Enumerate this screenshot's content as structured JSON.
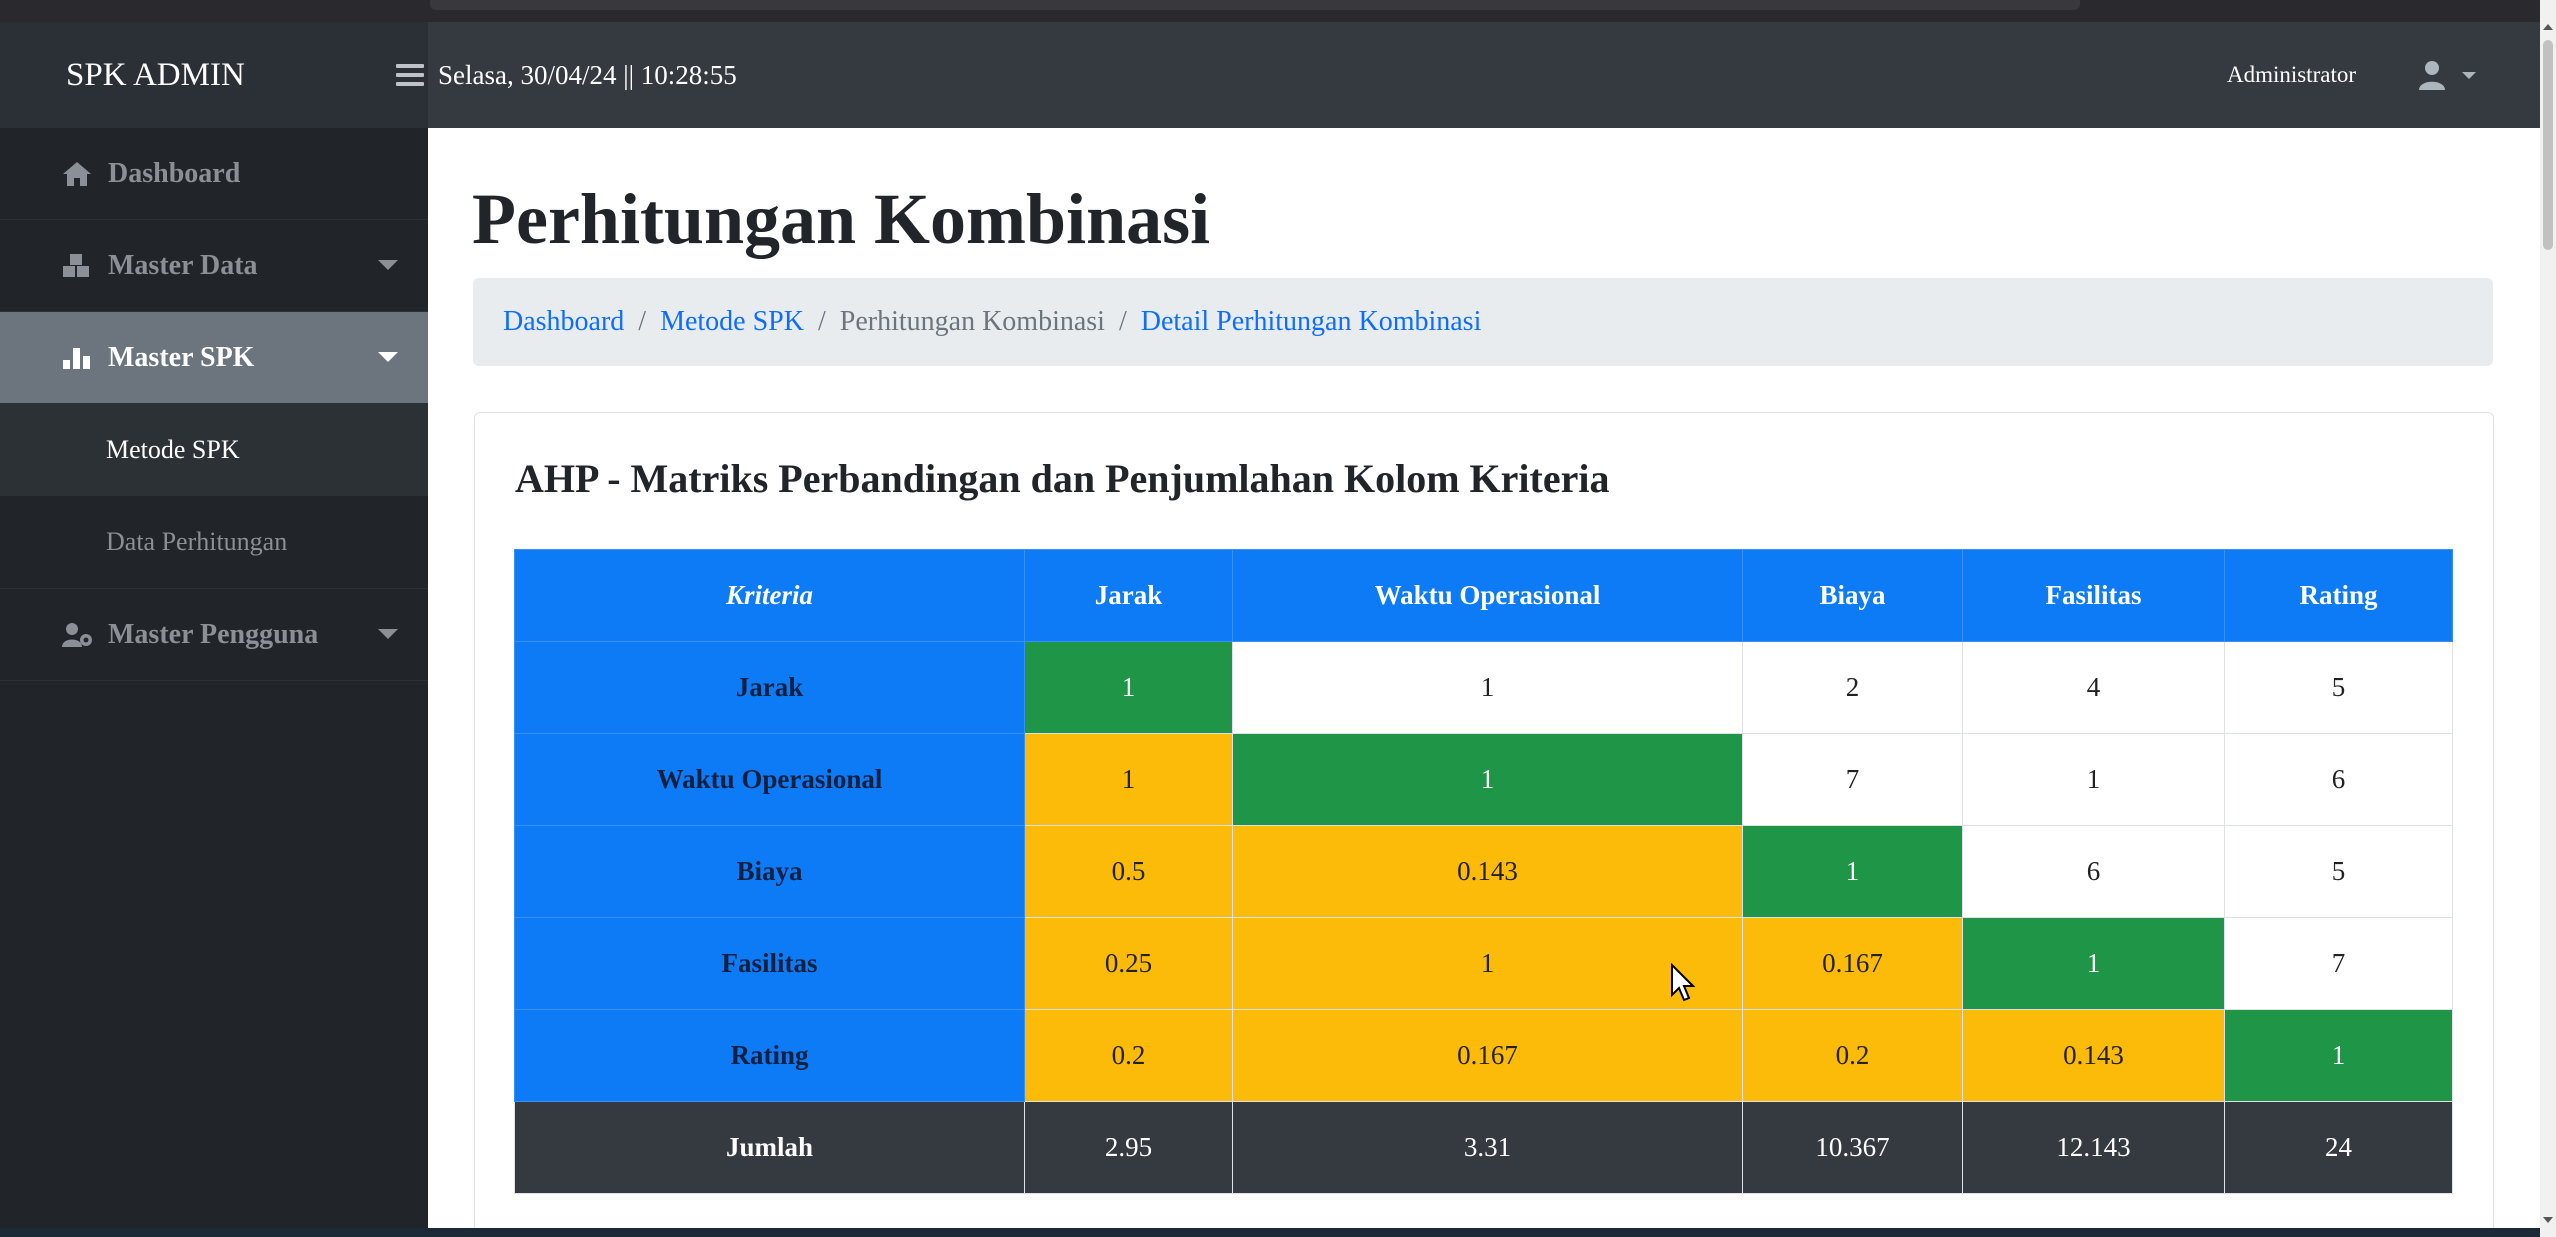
{
  "navbar": {
    "brand": "SPK ADMIN",
    "datetime": "Selasa, 30/04/24 || 10:28:55",
    "user_name": "Administrator"
  },
  "sidebar": {
    "items": [
      {
        "label": "Dashboard",
        "icon": "home-icon"
      },
      {
        "label": "Master Data",
        "icon": "cubes-icon"
      },
      {
        "label": "Master SPK",
        "icon": "chart-icon",
        "active": true
      },
      {
        "label": "Master Pengguna",
        "icon": "users-cog-icon"
      }
    ],
    "sub_items": [
      {
        "label": "Metode SPK",
        "selected": true
      },
      {
        "label": "Data Perhitungan"
      }
    ]
  },
  "page": {
    "title": "Perhitungan Kombinasi",
    "breadcrumb": [
      {
        "label": "Dashboard",
        "link": true
      },
      {
        "label": "Metode SPK",
        "link": true
      },
      {
        "label": "Perhitungan Kombinasi",
        "link": false
      },
      {
        "label": "Detail Perhitungan Kombinasi",
        "link": true
      }
    ],
    "breadcrumb_separator": "/"
  },
  "card": {
    "title": "AHP - Matriks Perbandingan dan Penjumlahan Kolom Kriteria"
  },
  "matrix": {
    "corner_header": "Kriteria",
    "columns": [
      "Jarak",
      "Waktu Operasional",
      "Biaya",
      "Fasilitas",
      "Rating"
    ],
    "rows": [
      {
        "label": "Jarak",
        "values": [
          "1",
          "1",
          "2",
          "4",
          "5"
        ]
      },
      {
        "label": "Waktu Operasional",
        "values": [
          "1",
          "1",
          "7",
          "1",
          "6"
        ]
      },
      {
        "label": "Biaya",
        "values": [
          "0.5",
          "0.143",
          "1",
          "6",
          "5"
        ]
      },
      {
        "label": "Fasilitas",
        "values": [
          "0.25",
          "1",
          "0.167",
          "1",
          "7"
        ]
      },
      {
        "label": "Rating",
        "values": [
          "0.2",
          "0.167",
          "0.2",
          "0.143",
          "1"
        ]
      }
    ],
    "total_label": "Jumlah",
    "totals": [
      "2.95",
      "3.31",
      "10.367",
      "12.143",
      "24"
    ]
  },
  "colors": {
    "header_blue": "#0d7bf5",
    "diagonal_green": "#1f9647",
    "lower_yellow": "#fcba09",
    "navbar_dark": "#343a40",
    "sidebar_dark": "#212529"
  }
}
